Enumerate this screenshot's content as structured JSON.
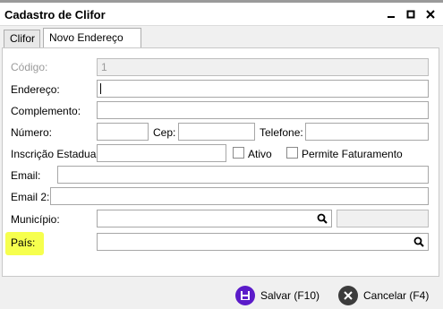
{
  "window": {
    "title": "Cadastro de Clifor"
  },
  "tabs": [
    {
      "label": "Clifor",
      "active": false
    },
    {
      "label": "Novo Endereço",
      "active": true
    }
  ],
  "form": {
    "codigo": {
      "label": "Código:",
      "value": "1",
      "disabled": true
    },
    "endereco": {
      "label": "Endereço:",
      "value": ""
    },
    "complemento": {
      "label": "Complemento:",
      "value": ""
    },
    "numero": {
      "label": "Número:",
      "value": ""
    },
    "cep": {
      "label": "Cep:",
      "value": ""
    },
    "telefone": {
      "label": "Telefone:",
      "value": ""
    },
    "inscricao": {
      "label": "Inscrição Estadual:",
      "value": ""
    },
    "ativo": {
      "label": "Ativo",
      "checked": false
    },
    "permite_faturamento": {
      "label": "Permite Faturamento",
      "checked": false
    },
    "email": {
      "label": "Email:",
      "value": ""
    },
    "email2": {
      "label": "Email 2:",
      "value": ""
    },
    "municipio": {
      "label": "Município:",
      "value": "",
      "extra_value": ""
    },
    "pais": {
      "label": "País:",
      "value": "",
      "highlight_color": "#f6ff4e"
    }
  },
  "footer": {
    "save_label": "Salvar (F10)",
    "cancel_label": "Cancelar (F4)",
    "save_icon": "save-icon",
    "cancel_icon": "cancel-icon",
    "save_color": "#5b1bc9",
    "cancel_color": "#3c3c3c"
  }
}
